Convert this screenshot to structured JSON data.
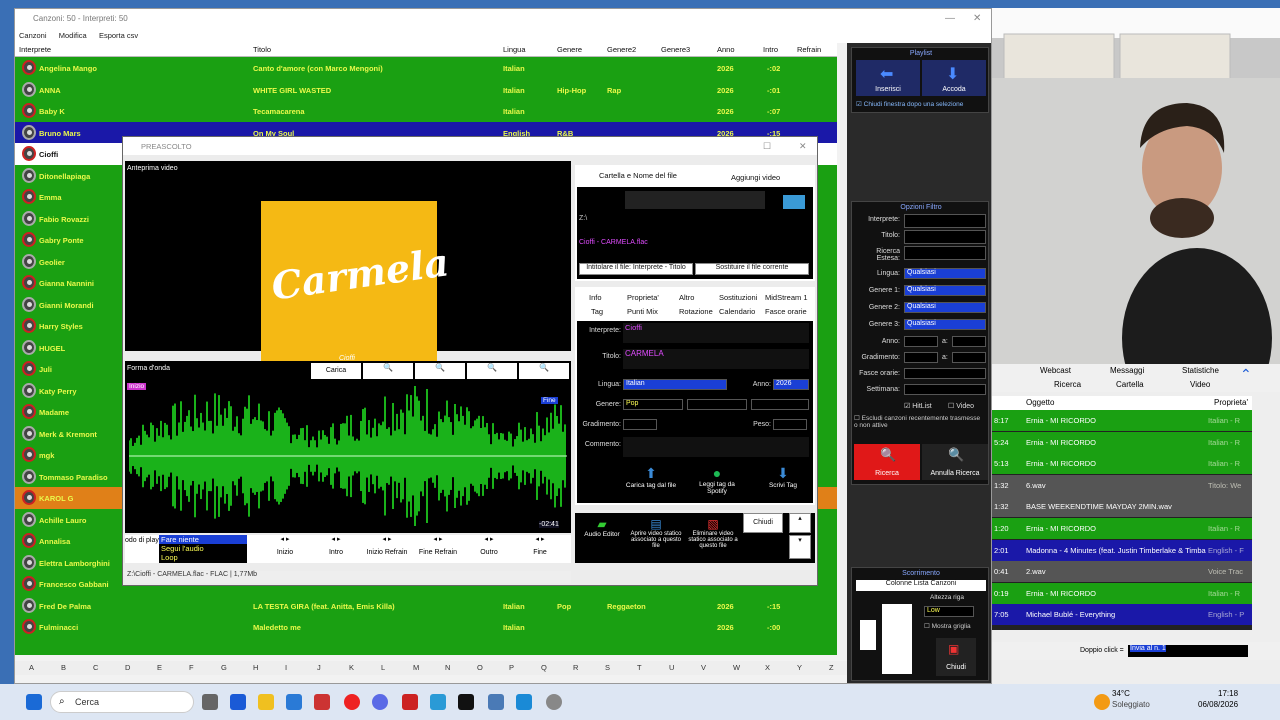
{
  "window": {
    "title": "Canzoni: 50 - Interpreti: 50"
  },
  "menu": [
    "Canzoni",
    "Modifica",
    "Esporta csv"
  ],
  "columns": [
    "Interprete",
    "Titolo",
    "Lingua",
    "Genere",
    "Genere2",
    "Genere3",
    "Anno",
    "Intro",
    "Refrain"
  ],
  "songs": [
    {
      "interprete": "Angelina Mango",
      "titolo": "Canto d'amore (con Marco Mengoni)",
      "lingua": "Italian",
      "genere": "",
      "genere2": "",
      "anno": "2026",
      "intro": "-:02",
      "style": "green"
    },
    {
      "interprete": "ANNA",
      "titolo": "WHITE GIRL WASTED",
      "lingua": "Italian",
      "genere": "Hip-Hop",
      "genere2": "Rap",
      "anno": "2026",
      "intro": "-:01",
      "style": "green"
    },
    {
      "interprete": "Baby K",
      "titolo": "Tecamacarena",
      "lingua": "Italian",
      "genere": "",
      "genere2": "",
      "anno": "2026",
      "intro": "-:07",
      "style": "green"
    },
    {
      "interprete": "Bruno Mars",
      "titolo": "On My Soul",
      "lingua": "English",
      "genere": "R&B",
      "genere2": "",
      "anno": "2026",
      "intro": "-:15",
      "style": "blue"
    },
    {
      "interprete": "Cioffi",
      "titolo": "",
      "lingua": "",
      "genere": "",
      "genere2": "",
      "anno": "",
      "intro": "",
      "style": "white"
    },
    {
      "interprete": "Ditonellapiaga",
      "titolo": "",
      "lingua": "",
      "genere": "",
      "genere2": "",
      "anno": "",
      "intro": "",
      "style": "green"
    },
    {
      "interprete": "Emma",
      "titolo": "",
      "lingua": "",
      "genere": "",
      "genere2": "",
      "anno": "",
      "intro": "",
      "style": "green"
    },
    {
      "interprete": "Fabio Rovazzi",
      "titolo": "",
      "lingua": "",
      "genere": "",
      "genere2": "",
      "anno": "",
      "intro": "",
      "style": "green"
    },
    {
      "interprete": "Gabry Ponte",
      "titolo": "",
      "lingua": "",
      "genere": "",
      "genere2": "",
      "anno": "",
      "intro": "",
      "style": "green"
    },
    {
      "interprete": "Geolier",
      "titolo": "",
      "lingua": "",
      "genere": "",
      "genere2": "",
      "anno": "",
      "intro": "",
      "style": "green"
    },
    {
      "interprete": "Gianna Nannini",
      "titolo": "",
      "lingua": "",
      "genere": "",
      "genere2": "",
      "anno": "",
      "intro": "",
      "style": "green"
    },
    {
      "interprete": "Gianni Morandi",
      "titolo": "",
      "lingua": "",
      "genere": "",
      "genere2": "",
      "anno": "",
      "intro": "",
      "style": "green"
    },
    {
      "interprete": "Harry Styles",
      "titolo": "",
      "lingua": "",
      "genere": "",
      "genere2": "",
      "anno": "",
      "intro": "",
      "style": "green"
    },
    {
      "interprete": "HUGEL",
      "titolo": "",
      "lingua": "",
      "genere": "",
      "genere2": "",
      "anno": "",
      "intro": "",
      "style": "green"
    },
    {
      "interprete": "Juli",
      "titolo": "",
      "lingua": "",
      "genere": "",
      "genere2": "",
      "anno": "",
      "intro": "",
      "style": "green"
    },
    {
      "interprete": "Katy Perry",
      "titolo": "",
      "lingua": "",
      "genere": "",
      "genere2": "",
      "anno": "",
      "intro": "",
      "style": "green"
    },
    {
      "interprete": "Madame",
      "titolo": "",
      "lingua": "",
      "genere": "",
      "genere2": "",
      "anno": "",
      "intro": "",
      "style": "green"
    },
    {
      "interprete": "Merk & Kremont",
      "titolo": "",
      "lingua": "",
      "genere": "",
      "genere2": "",
      "anno": "",
      "intro": "",
      "style": "green"
    },
    {
      "interprete": "mgk",
      "titolo": "",
      "lingua": "",
      "genere": "",
      "genere2": "",
      "anno": "",
      "intro": "",
      "style": "green"
    },
    {
      "interprete": "Tommaso Paradiso",
      "titolo": "",
      "lingua": "",
      "genere": "",
      "genere2": "",
      "anno": "",
      "intro": "",
      "style": "green"
    },
    {
      "interprete": "KAROL G",
      "titolo": "",
      "lingua": "",
      "genere": "",
      "genere2": "",
      "anno": "",
      "intro": "",
      "style": "orange"
    },
    {
      "interprete": "Achille Lauro",
      "titolo": "",
      "lingua": "",
      "genere": "",
      "genere2": "",
      "anno": "",
      "intro": "",
      "style": "green"
    },
    {
      "interprete": "Annalisa",
      "titolo": "",
      "lingua": "",
      "genere": "",
      "genere2": "",
      "anno": "",
      "intro": "",
      "style": "green"
    },
    {
      "interprete": "Elettra Lamborghini",
      "titolo": "",
      "lingua": "",
      "genere": "",
      "genere2": "",
      "anno": "",
      "intro": "",
      "style": "green"
    },
    {
      "interprete": "Francesco Gabbani",
      "titolo": "",
      "lingua": "",
      "genere": "",
      "genere2": "",
      "anno": "",
      "intro": "",
      "style": "green"
    },
    {
      "interprete": "Fred De Palma",
      "titolo": "LA TESTA GIRA (feat. Anitta, Emis Killa)",
      "lingua": "Italian",
      "genere": "Pop",
      "genere2": "Reggaeton",
      "anno": "2026",
      "intro": "-:15",
      "style": "green"
    },
    {
      "interprete": "Fulminacci",
      "titolo": "Maledetto me",
      "lingua": "Italian",
      "genere": "",
      "genere2": "",
      "anno": "2026",
      "intro": "-:00",
      "style": "green"
    }
  ],
  "alphabet": [
    "A",
    "B",
    "C",
    "D",
    "E",
    "F",
    "G",
    "H",
    "I",
    "J",
    "K",
    "L",
    "M",
    "N",
    "O",
    "P",
    "Q",
    "R",
    "S",
    "T",
    "U",
    "V",
    "W",
    "X",
    "Y",
    "Z"
  ],
  "playlist": {
    "title": "Playlist",
    "inserisci": "Inserisci",
    "accoda": "Accoda",
    "chiudi_check": "Chiudi finestra dopo una selezione"
  },
  "filtro": {
    "title": "Opzioni Filtro",
    "labels": [
      "Interprete:",
      "Titolo:",
      "Ricerca Estesa:",
      "Lingua:",
      "Genere 1:",
      "Genere 2:",
      "Genere 3:",
      "Anno:",
      "Gradimento:",
      "Fasce orarie:",
      "Settimana:"
    ],
    "qualsiasi": "Qualsiasi",
    "anno_a": "a:",
    "hitlist": "HitList",
    "video": "Video",
    "escludi": "Escludi canzoni recentemente trasmesse o non attive",
    "ricerca": "Ricerca",
    "annulla": "Annulla Ricerca"
  },
  "scorrimento": {
    "title": "Scorrimento",
    "colonne": "Colonne Lista Canzoni",
    "altezza": "Altezza riga",
    "altezza_val": "Low",
    "mostra_griglia": "Mostra griglia",
    "chiudi": "Chiudi"
  },
  "preascolto": {
    "title": "PREASCOLTO",
    "anteprima": "Anteprima video",
    "cover_text": "Carmela",
    "cover_sig": "Cioffi",
    "forma": "Forma d'onda",
    "carica": "Carica",
    "inizio_tag": "Inizio",
    "fine_tag": "Fine",
    "time": "-02:41",
    "modo_label": "odo di play",
    "modo_options": [
      "Fare niente",
      "Segui l'audio",
      "Loop"
    ],
    "markers": [
      "Inizio",
      "Intro",
      "Inizio Refrain",
      "Fine Refrain",
      "Outro",
      "Fine"
    ],
    "status": "Z:\\Cioffi - CARMELA.flac - FLAC | 1,77Mb",
    "tab_cartella": "Cartella e Nome del file",
    "tab_aggiungi": "Aggiungi video",
    "path": "Z:\\",
    "file": "Cioffi - CARMELA.flac",
    "btn_intitolare": "Intitolare il file: Interprete - Titolo",
    "btn_sostituire": "Sostituire il file corrente",
    "tabs_row1": [
      "Info",
      "Proprieta'",
      "Altro",
      "Sostituzioni",
      "MidStream 1"
    ],
    "tabs_row2": [
      "Tag",
      "Punti Mix",
      "Rotazione",
      "Calendario",
      "Fasce orarie"
    ],
    "interprete_label": "Interprete:",
    "interprete": "Cioffi",
    "titolo_label": "Titolo:",
    "titolo": "CARMELA",
    "lingua_label": "Lingua:",
    "lingua": "Italian",
    "anno_label": "Anno:",
    "anno": "2026",
    "genere_label": "Genere:",
    "genere": "Pop",
    "gradimento_label": "Gradimento:",
    "peso_label": "Peso:",
    "commento_label": "Commento:",
    "carica_tag": "Carica tag dal file",
    "leggi_tag": "Leggi tag da Spotify",
    "scrivi_tag": "Scrivi Tag",
    "audio_editor": "Audio Editor",
    "aprire_video": "Aprire video statico associato a questo file",
    "eliminare_video": "Eliminare video statico associato a questo file",
    "chiudi": "Chiudi"
  },
  "log": {
    "tabs1": [
      "Webcast",
      "Messaggi",
      "Statistiche"
    ],
    "tabs2": [
      "Ricerca",
      "Cartella",
      "Video"
    ],
    "col_oggetto": "Oggetto",
    "col_prop": "Proprieta'",
    "rows": [
      {
        "time": "8:17",
        "obj": "Ernia - MI RICORDO",
        "prop": "Italian - R",
        "style": "green"
      },
      {
        "time": "5:24",
        "obj": "Ernia - MI RICORDO",
        "prop": "Italian - R",
        "style": "green"
      },
      {
        "time": "5:13",
        "obj": "Ernia - MI RICORDO",
        "prop": "Italian - R",
        "style": "green"
      },
      {
        "time": "1:32",
        "obj": "6.wav",
        "prop": "Titolo: We",
        "style": "gray"
      },
      {
        "time": "1:32",
        "obj": "BASE WEEKENDTIME MAYDAY 2MIN.wav",
        "prop": "",
        "style": "gray"
      },
      {
        "time": "1:20",
        "obj": "Ernia - MI RICORDO",
        "prop": "Italian - R",
        "style": "green"
      },
      {
        "time": "2:01",
        "obj": "Madonna - 4 Minutes (feat. Justin Timberlake & Timbaland)",
        "prop": "English - F",
        "style": "blue"
      },
      {
        "time": "0:41",
        "obj": "2.wav",
        "prop": "Voice Trac",
        "style": "gray"
      },
      {
        "time": "0:19",
        "obj": "Ernia - MI RICORDO",
        "prop": "Italian - R",
        "style": "green"
      },
      {
        "time": "7:05",
        "obj": "Michael Bublé - Everything",
        "prop": "English - P",
        "style": "blue"
      }
    ],
    "doppio_label": "Doppio click =",
    "doppio_val": "Invia al n. 1"
  },
  "taskbar": {
    "search": "Cerca",
    "temp": "34°C",
    "weather": "Soleggiato",
    "time": "17:18",
    "date": "06/08/2026"
  }
}
